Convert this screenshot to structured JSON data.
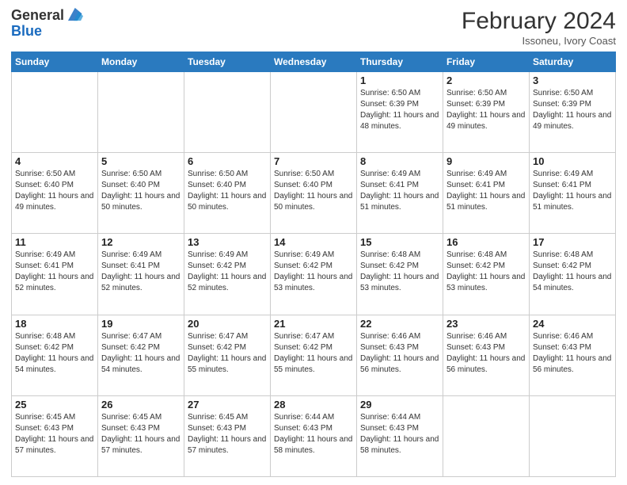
{
  "header": {
    "logo_general": "General",
    "logo_blue": "Blue",
    "month_year": "February 2024",
    "location": "Issoneu, Ivory Coast"
  },
  "days_of_week": [
    "Sunday",
    "Monday",
    "Tuesday",
    "Wednesday",
    "Thursday",
    "Friday",
    "Saturday"
  ],
  "weeks": [
    [
      {
        "day": "",
        "info": ""
      },
      {
        "day": "",
        "info": ""
      },
      {
        "day": "",
        "info": ""
      },
      {
        "day": "",
        "info": ""
      },
      {
        "day": "1",
        "info": "Sunrise: 6:50 AM\nSunset: 6:39 PM\nDaylight: 11 hours and 48 minutes."
      },
      {
        "day": "2",
        "info": "Sunrise: 6:50 AM\nSunset: 6:39 PM\nDaylight: 11 hours and 49 minutes."
      },
      {
        "day": "3",
        "info": "Sunrise: 6:50 AM\nSunset: 6:39 PM\nDaylight: 11 hours and 49 minutes."
      }
    ],
    [
      {
        "day": "4",
        "info": "Sunrise: 6:50 AM\nSunset: 6:40 PM\nDaylight: 11 hours and 49 minutes."
      },
      {
        "day": "5",
        "info": "Sunrise: 6:50 AM\nSunset: 6:40 PM\nDaylight: 11 hours and 50 minutes."
      },
      {
        "day": "6",
        "info": "Sunrise: 6:50 AM\nSunset: 6:40 PM\nDaylight: 11 hours and 50 minutes."
      },
      {
        "day": "7",
        "info": "Sunrise: 6:50 AM\nSunset: 6:40 PM\nDaylight: 11 hours and 50 minutes."
      },
      {
        "day": "8",
        "info": "Sunrise: 6:49 AM\nSunset: 6:41 PM\nDaylight: 11 hours and 51 minutes."
      },
      {
        "day": "9",
        "info": "Sunrise: 6:49 AM\nSunset: 6:41 PM\nDaylight: 11 hours and 51 minutes."
      },
      {
        "day": "10",
        "info": "Sunrise: 6:49 AM\nSunset: 6:41 PM\nDaylight: 11 hours and 51 minutes."
      }
    ],
    [
      {
        "day": "11",
        "info": "Sunrise: 6:49 AM\nSunset: 6:41 PM\nDaylight: 11 hours and 52 minutes."
      },
      {
        "day": "12",
        "info": "Sunrise: 6:49 AM\nSunset: 6:41 PM\nDaylight: 11 hours and 52 minutes."
      },
      {
        "day": "13",
        "info": "Sunrise: 6:49 AM\nSunset: 6:42 PM\nDaylight: 11 hours and 52 minutes."
      },
      {
        "day": "14",
        "info": "Sunrise: 6:49 AM\nSunset: 6:42 PM\nDaylight: 11 hours and 53 minutes."
      },
      {
        "day": "15",
        "info": "Sunrise: 6:48 AM\nSunset: 6:42 PM\nDaylight: 11 hours and 53 minutes."
      },
      {
        "day": "16",
        "info": "Sunrise: 6:48 AM\nSunset: 6:42 PM\nDaylight: 11 hours and 53 minutes."
      },
      {
        "day": "17",
        "info": "Sunrise: 6:48 AM\nSunset: 6:42 PM\nDaylight: 11 hours and 54 minutes."
      }
    ],
    [
      {
        "day": "18",
        "info": "Sunrise: 6:48 AM\nSunset: 6:42 PM\nDaylight: 11 hours and 54 minutes."
      },
      {
        "day": "19",
        "info": "Sunrise: 6:47 AM\nSunset: 6:42 PM\nDaylight: 11 hours and 54 minutes."
      },
      {
        "day": "20",
        "info": "Sunrise: 6:47 AM\nSunset: 6:42 PM\nDaylight: 11 hours and 55 minutes."
      },
      {
        "day": "21",
        "info": "Sunrise: 6:47 AM\nSunset: 6:42 PM\nDaylight: 11 hours and 55 minutes."
      },
      {
        "day": "22",
        "info": "Sunrise: 6:46 AM\nSunset: 6:43 PM\nDaylight: 11 hours and 56 minutes."
      },
      {
        "day": "23",
        "info": "Sunrise: 6:46 AM\nSunset: 6:43 PM\nDaylight: 11 hours and 56 minutes."
      },
      {
        "day": "24",
        "info": "Sunrise: 6:46 AM\nSunset: 6:43 PM\nDaylight: 11 hours and 56 minutes."
      }
    ],
    [
      {
        "day": "25",
        "info": "Sunrise: 6:45 AM\nSunset: 6:43 PM\nDaylight: 11 hours and 57 minutes."
      },
      {
        "day": "26",
        "info": "Sunrise: 6:45 AM\nSunset: 6:43 PM\nDaylight: 11 hours and 57 minutes."
      },
      {
        "day": "27",
        "info": "Sunrise: 6:45 AM\nSunset: 6:43 PM\nDaylight: 11 hours and 57 minutes."
      },
      {
        "day": "28",
        "info": "Sunrise: 6:44 AM\nSunset: 6:43 PM\nDaylight: 11 hours and 58 minutes."
      },
      {
        "day": "29",
        "info": "Sunrise: 6:44 AM\nSunset: 6:43 PM\nDaylight: 11 hours and 58 minutes."
      },
      {
        "day": "",
        "info": ""
      },
      {
        "day": "",
        "info": ""
      }
    ]
  ]
}
